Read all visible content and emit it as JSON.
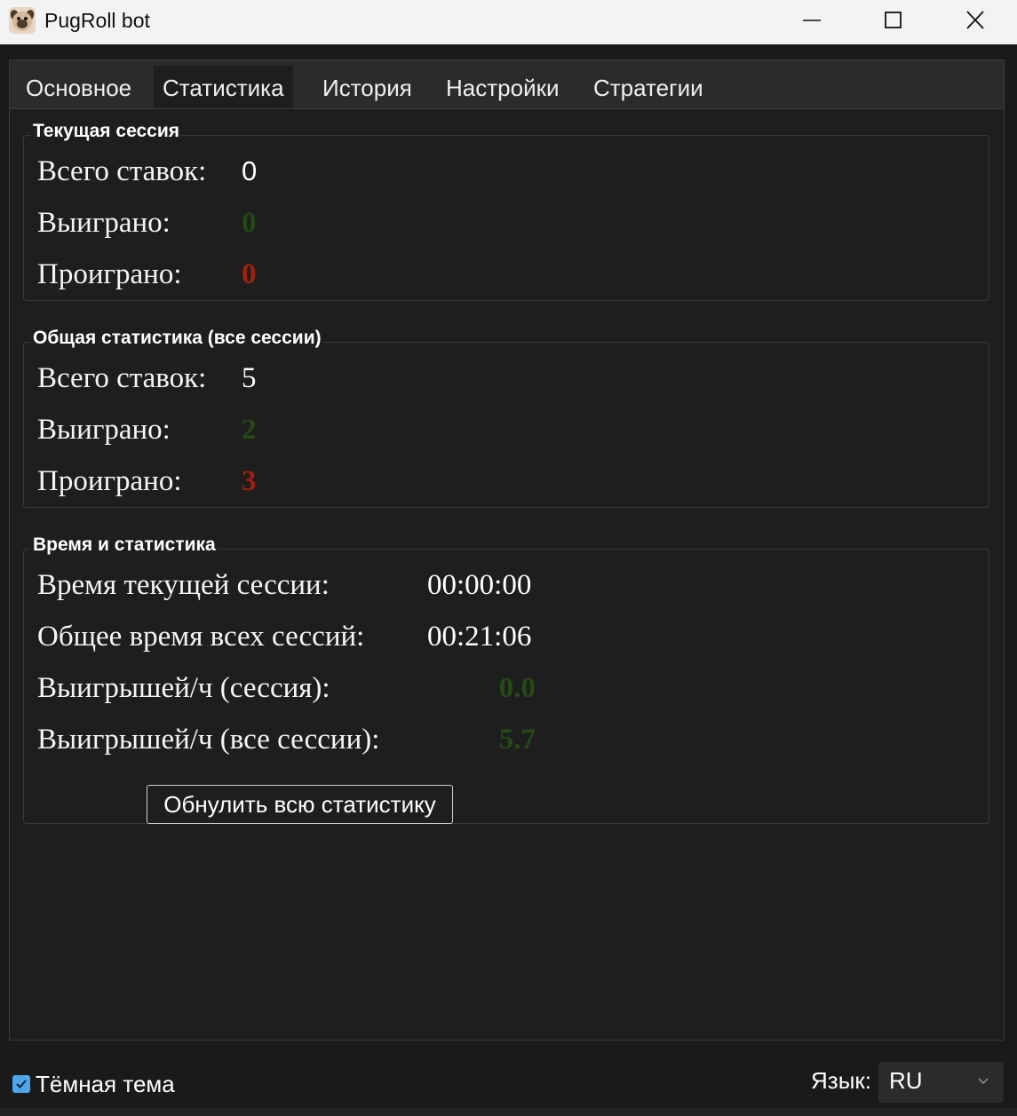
{
  "window": {
    "title": "PugRoll bot"
  },
  "tabs": [
    "Основное",
    "Статистика",
    "История",
    "Настройки",
    "Стратегии"
  ],
  "active_tab": "Статистика",
  "current_session": {
    "title": "Текущая сессия",
    "total_label": "Всего ставок:",
    "total_value": "0",
    "won_label": "Выиграно:",
    "won_value": "0",
    "lost_label": "Проиграно:",
    "lost_value": "0"
  },
  "overall_stats": {
    "title": "Общая статистика (все сессии)",
    "total_label": "Всего ставок:",
    "total_value": "5",
    "won_label": "Выиграно:",
    "won_value": "2",
    "lost_label": "Проиграно:",
    "lost_value": "3"
  },
  "time_stats": {
    "title": "Время и статистика",
    "session_time_label": "Время текущей сессии:",
    "session_time_value": "00:00:00",
    "total_time_label": "Общее время всех сессий:",
    "total_time_value": "00:21:06",
    "wins_per_hour_session_label": "Выигрышей/ч (сессия):",
    "wins_per_hour_session_value": "0.0",
    "wins_per_hour_all_label": "Выигрышей/ч (все сессии):",
    "wins_per_hour_all_value": "5.7",
    "reset_button": "Обнулить всю статистику"
  },
  "footer": {
    "dark_theme_label": "Тёмная тема",
    "dark_theme_checked": true,
    "language_label": "Язык:",
    "language_value": "RU"
  },
  "colors": {
    "win": "#244a16",
    "loss": "#a0210e",
    "accent": "#4ea6e8"
  }
}
